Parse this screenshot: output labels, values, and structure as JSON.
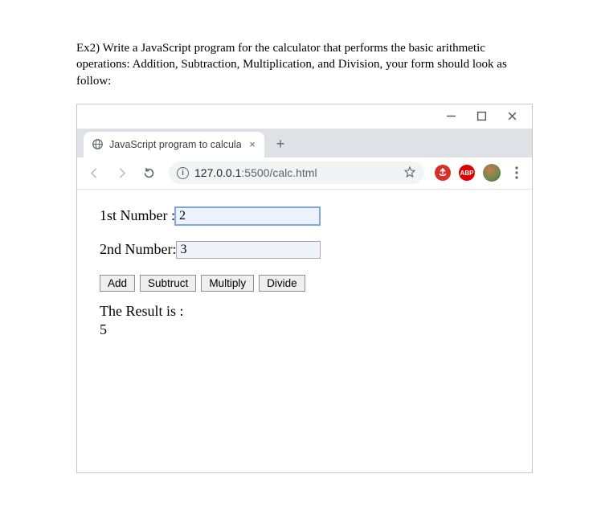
{
  "instructions": "Ex2) Write a JavaScript program for the calculator that performs the basic arithmetic operations: Addition, Subtraction, Multiplication, and Division, your form should look as follow:",
  "window": {
    "minimize": "—",
    "maximize": "☐",
    "close": "✕"
  },
  "tab": {
    "title": "JavaScript program to calculate n",
    "close": "×"
  },
  "newtab": "+",
  "omnibox": {
    "host": "127.0.0.1",
    "port": ":5500",
    "path": "/calc.html"
  },
  "extensions": {
    "ublock": "✋",
    "abp": "ABP"
  },
  "form": {
    "label1": "1st Number : ",
    "value1": "2",
    "label2": "2nd Number: ",
    "value2": "3",
    "buttons": {
      "add": "Add",
      "subtract": "Subtruct",
      "multiply": "Multiply",
      "divide": "Divide"
    },
    "result_label": "The Result is :",
    "result_value": "5"
  }
}
